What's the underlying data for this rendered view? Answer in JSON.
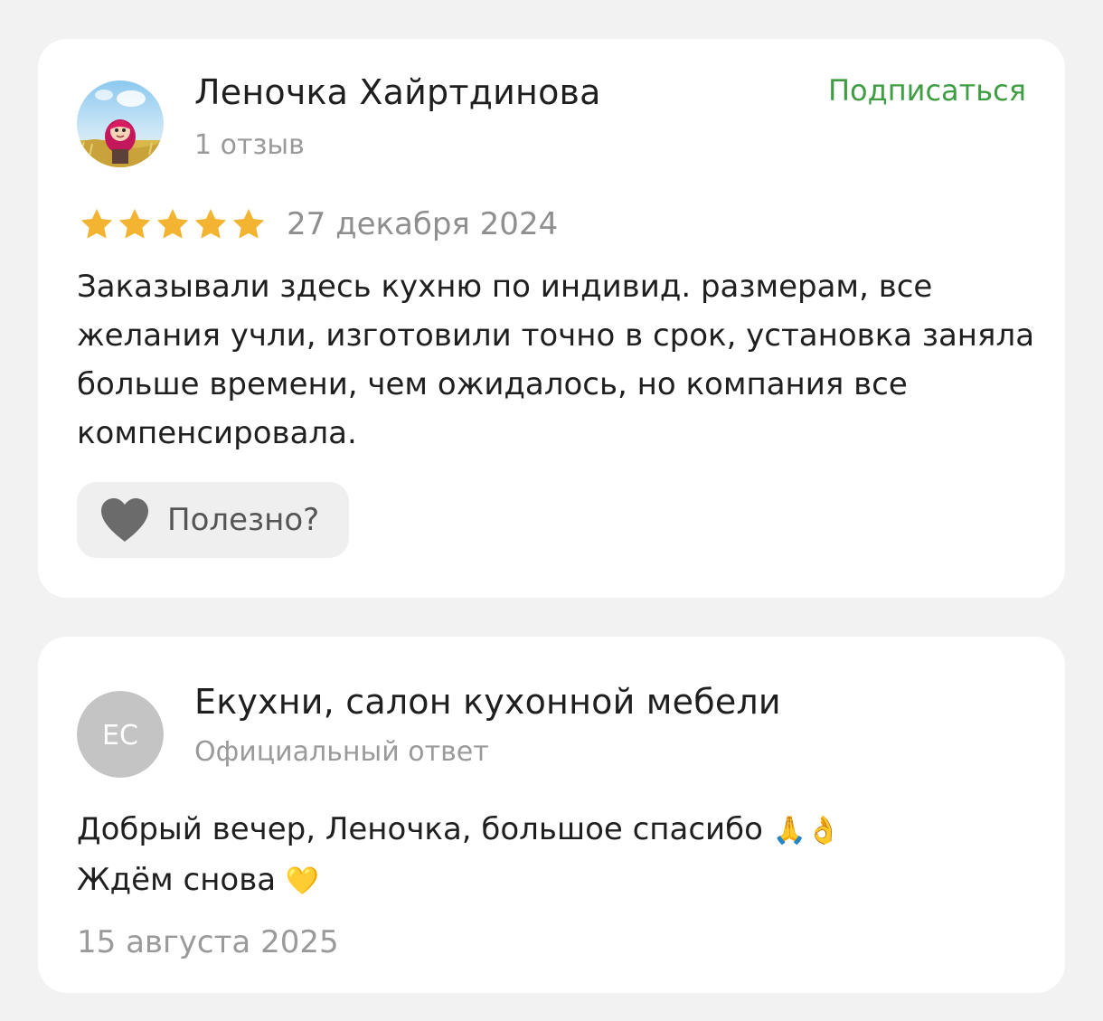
{
  "review": {
    "author_name": "Леночка Хайртдинова",
    "author_sub": "1 отзыв",
    "subscribe_label": "Подписаться",
    "rating": 5,
    "rating_max": 5,
    "date": "27 декабря 2024",
    "text": "Заказывали здесь кухню по индивид. размерам, все желания учли, изготовили точно в срок, установка заняла больше времени, чем ожидалось, но компания все компенсировала.",
    "useful_label": "Полезно?"
  },
  "reply": {
    "avatar_initials": "ЕС",
    "author_name": "Екухни, салон кухонной мебели",
    "author_sub": "Официальный ответ",
    "line1": "Добрый вечер, Леночка, большое спасибо",
    "line1_emoji": "🙏👌",
    "line2": "Ждём снова",
    "line2_emoji": "💛",
    "date": "15 августа 2025"
  },
  "colors": {
    "accent_green": "#3f9e44",
    "star_gold": "#f2b431",
    "muted_text": "#9a9a9a",
    "card_bg": "#ffffff",
    "page_bg": "#f2f2f2"
  }
}
